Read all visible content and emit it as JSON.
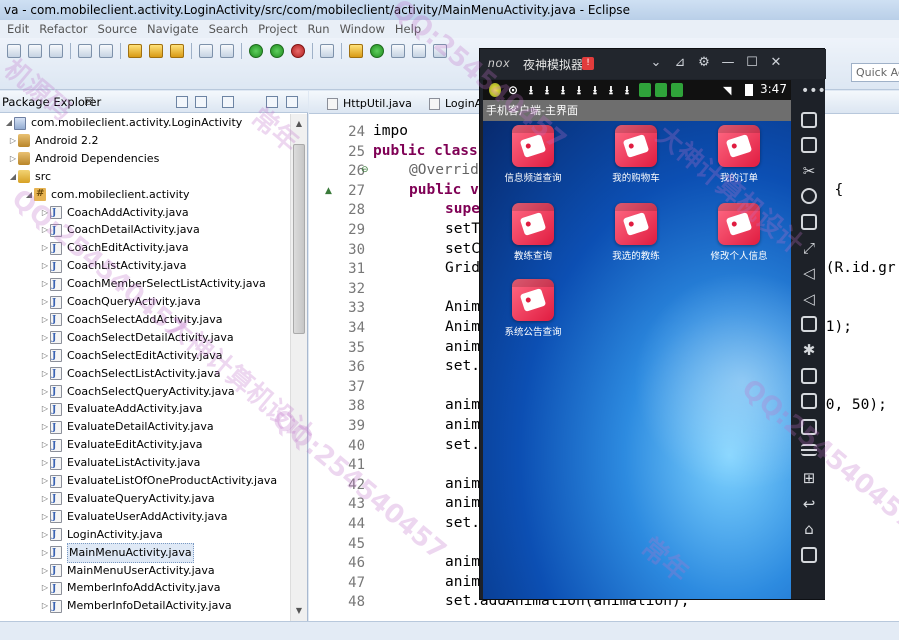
{
  "window": {
    "title": "va - com.mobileclient.activity.LoginActivity/src/com/mobileclient/activity/MainMenuActivity.java - Eclipse"
  },
  "menu": [
    "Edit",
    "Refactor",
    "Source",
    "Navigate",
    "Search",
    "Project",
    "Run",
    "Window",
    "Help"
  ],
  "toolbar": {
    "quick_access_placeholder": "Quick Ac"
  },
  "package_explorer": {
    "title": "Package Explorer",
    "close_glyph": "☒",
    "tree": [
      {
        "label": "com.mobileclient.activity.LoginActivity",
        "icon": "project-icon",
        "arrow": "◢"
      },
      {
        "label": "Android 2.2",
        "icon": "library-icon",
        "arrow": "▷"
      },
      {
        "label": "Android Dependencies",
        "icon": "library-icon",
        "arrow": "▷"
      },
      {
        "label": "src",
        "icon": "source-folder-icon",
        "arrow": "◢"
      },
      {
        "label": "com.mobileclient.activity",
        "icon": "package-icon",
        "arrow": "◢"
      },
      {
        "label": "CoachAddActivity.java",
        "icon": "java-file-icon",
        "arrow": "▷"
      },
      {
        "label": "CoachDetailActivity.java",
        "icon": "java-file-icon",
        "arrow": "▷"
      },
      {
        "label": "CoachEditActivity.java",
        "icon": "java-file-icon",
        "arrow": "▷"
      },
      {
        "label": "CoachListActivity.java",
        "icon": "java-file-icon",
        "arrow": "▷"
      },
      {
        "label": "CoachMemberSelectListActivity.java",
        "icon": "java-file-icon",
        "arrow": "▷"
      },
      {
        "label": "CoachQueryActivity.java",
        "icon": "java-file-icon",
        "arrow": "▷"
      },
      {
        "label": "CoachSelectAddActivity.java",
        "icon": "java-file-icon",
        "arrow": "▷"
      },
      {
        "label": "CoachSelectDetailActivity.java",
        "icon": "java-file-icon",
        "arrow": "▷"
      },
      {
        "label": "CoachSelectEditActivity.java",
        "icon": "java-file-icon",
        "arrow": "▷"
      },
      {
        "label": "CoachSelectListActivity.java",
        "icon": "java-file-icon",
        "arrow": "▷"
      },
      {
        "label": "CoachSelectQueryActivity.java",
        "icon": "java-file-icon",
        "arrow": "▷"
      },
      {
        "label": "EvaluateAddActivity.java",
        "icon": "java-file-icon",
        "arrow": "▷"
      },
      {
        "label": "EvaluateDetailActivity.java",
        "icon": "java-file-icon",
        "arrow": "▷"
      },
      {
        "label": "EvaluateEditActivity.java",
        "icon": "java-file-icon",
        "arrow": "▷"
      },
      {
        "label": "EvaluateListActivity.java",
        "icon": "java-file-icon",
        "arrow": "▷"
      },
      {
        "label": "EvaluateListOfOneProductActivity.java",
        "icon": "java-file-icon",
        "arrow": "▷"
      },
      {
        "label": "EvaluateQueryActivity.java",
        "icon": "java-file-icon",
        "arrow": "▷"
      },
      {
        "label": "EvaluateUserAddActivity.java",
        "icon": "java-file-icon",
        "arrow": "▷"
      },
      {
        "label": "LoginActivity.java",
        "icon": "java-file-icon",
        "arrow": "▷"
      },
      {
        "label": "MainMenuActivity.java",
        "icon": "java-file-icon",
        "arrow": "▷",
        "selected": true
      },
      {
        "label": "MainMenuUserActivity.java",
        "icon": "java-file-icon",
        "arrow": "▷"
      },
      {
        "label": "MemberInfoAddActivity.java",
        "icon": "java-file-icon",
        "arrow": "▷"
      },
      {
        "label": "MemberInfoDetailActivity.java",
        "icon": "java-file-icon",
        "arrow": "▷"
      }
    ]
  },
  "editor": {
    "tabs": [
      "HttpUtil.java",
      "LoginA"
    ],
    "lines": [
      {
        "n": "24",
        "segs": [
          [
            "",
            "impo"
          ]
        ]
      },
      {
        "n": "25",
        "segs": [
          [
            "kw",
            "public class"
          ]
        ]
      },
      {
        "n": "26",
        "segs": [
          [
            "ann",
            "@Overrid"
          ]
        ]
      },
      {
        "n": "27",
        "segs": [
          [
            "kw",
            "public v"
          ]
        ]
      },
      {
        "n": "28",
        "segs": [
          [
            "kw",
            "supe"
          ]
        ]
      },
      {
        "n": "29",
        "segs": [
          [
            "",
            "setT"
          ]
        ]
      },
      {
        "n": "30",
        "segs": [
          [
            "",
            "setC"
          ]
        ]
      },
      {
        "n": "31",
        "segs": [
          [
            "",
            "Grid"
          ]
        ]
      },
      {
        "n": "32",
        "segs": [
          [
            "",
            ""
          ]
        ]
      },
      {
        "n": "33",
        "segs": [
          [
            "",
            "Anim"
          ]
        ]
      },
      {
        "n": "34",
        "segs": [
          [
            "",
            "Anim"
          ]
        ]
      },
      {
        "n": "35",
        "segs": [
          [
            "",
            "anim"
          ]
        ]
      },
      {
        "n": "36",
        "segs": [
          [
            "",
            "set."
          ]
        ]
      },
      {
        "n": "37",
        "segs": [
          [
            "",
            ""
          ]
        ]
      },
      {
        "n": "38",
        "segs": [
          [
            "",
            "anim"
          ]
        ]
      },
      {
        "n": "39",
        "segs": [
          [
            "",
            "anim"
          ]
        ]
      },
      {
        "n": "40",
        "segs": [
          [
            "",
            "set."
          ]
        ]
      },
      {
        "n": "41",
        "segs": [
          [
            "",
            ""
          ]
        ]
      },
      {
        "n": "42",
        "segs": [
          [
            "",
            "anim"
          ]
        ]
      },
      {
        "n": "43",
        "segs": [
          [
            "",
            "anim"
          ]
        ]
      },
      {
        "n": "44",
        "segs": [
          [
            "",
            "set."
          ]
        ]
      },
      {
        "n": "45",
        "segs": [
          [
            "",
            ""
          ]
        ]
      },
      {
        "n": "46",
        "segs": [
          [
            "",
            "anim"
          ]
        ]
      },
      {
        "n": "47",
        "segs": [
          [
            "",
            "anim"
          ]
        ]
      },
      {
        "n": "48",
        "segs": [
          [
            "",
            "set.addAnimation(animation);"
          ]
        ]
      }
    ],
    "right_fragments": [
      {
        "line": "27",
        "text": ") {"
      },
      {
        "line": "31",
        "text": "d(R.id.gr"
      },
      {
        "line": "33",
        "text": ";"
      },
      {
        "line": "34",
        "text": ",1);"
      },
      {
        "line": "38",
        "text": "10, 50);"
      }
    ]
  },
  "emulator": {
    "brand": "nox",
    "name": "夜神模拟器",
    "badge": "!",
    "time": "3:47",
    "app_title": "手机客户端-主界面",
    "apps": [
      "信息频道查询",
      "我的购物车",
      "我的订单",
      "教练查询",
      "我选的教练",
      "修改个人信息",
      "系统公告查询"
    ],
    "window_controls": [
      "⌄",
      "⊿",
      "⚙",
      "—",
      "☐",
      "✕"
    ]
  },
  "watermark": [
    "QQ:254540457",
    "常年",
    "大神计算机设计",
    "机源码"
  ]
}
